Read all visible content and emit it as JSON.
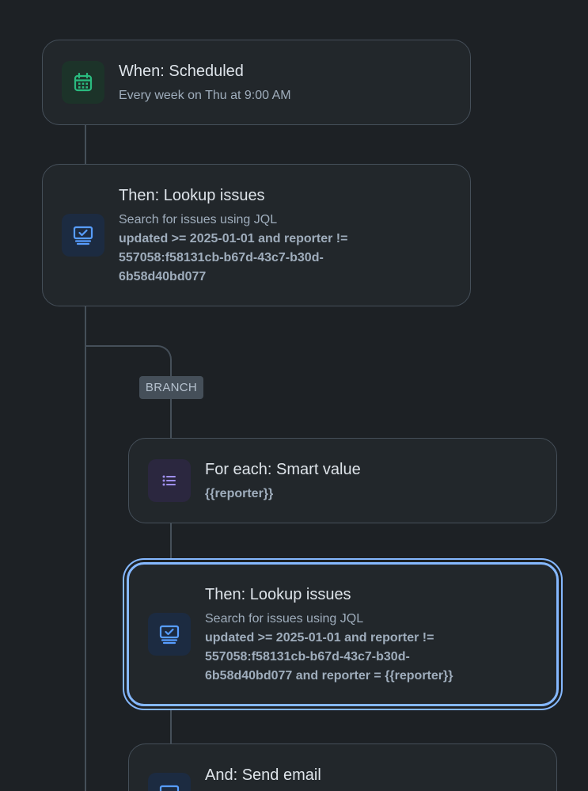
{
  "rule": {
    "trigger": {
      "icon": "calendar-icon",
      "title": "When: Scheduled",
      "subtitle": "Every week on Thu at 9:00 AM"
    },
    "lookup1": {
      "icon": "lookup-issues-icon",
      "title": "Then: Lookup issues",
      "subtitle": "Search for issues using JQL",
      "jql": "updated >= 2025-01-01 and reporter !=\n557058:f58131cb-b67d-43c7-b30d-\n6b58d40bd077"
    },
    "branch": {
      "badge": "BRANCH",
      "foreach": {
        "icon": "list-icon",
        "title": "For each: Smart value",
        "value": "{{reporter}}"
      },
      "lookup2": {
        "icon": "lookup-issues-icon",
        "title": "Then: Lookup issues",
        "subtitle": "Search for issues using JQL",
        "jql": "updated >= 2025-01-01 and reporter !=\n557058:f58131cb-b67d-43c7-b30d-\n6b58d40bd077 and reporter = {{reporter}}"
      },
      "email": {
        "icon": "email-action-icon",
        "title": "And: Send email"
      }
    }
  },
  "colors": {
    "background": "#1d2125",
    "card": "#22272b",
    "connector": "#454f59",
    "selected_border": "#85b8ff",
    "green_icon": "#2abb7f",
    "blue_icon": "#579dff",
    "purple_icon": "#9f8fef"
  }
}
